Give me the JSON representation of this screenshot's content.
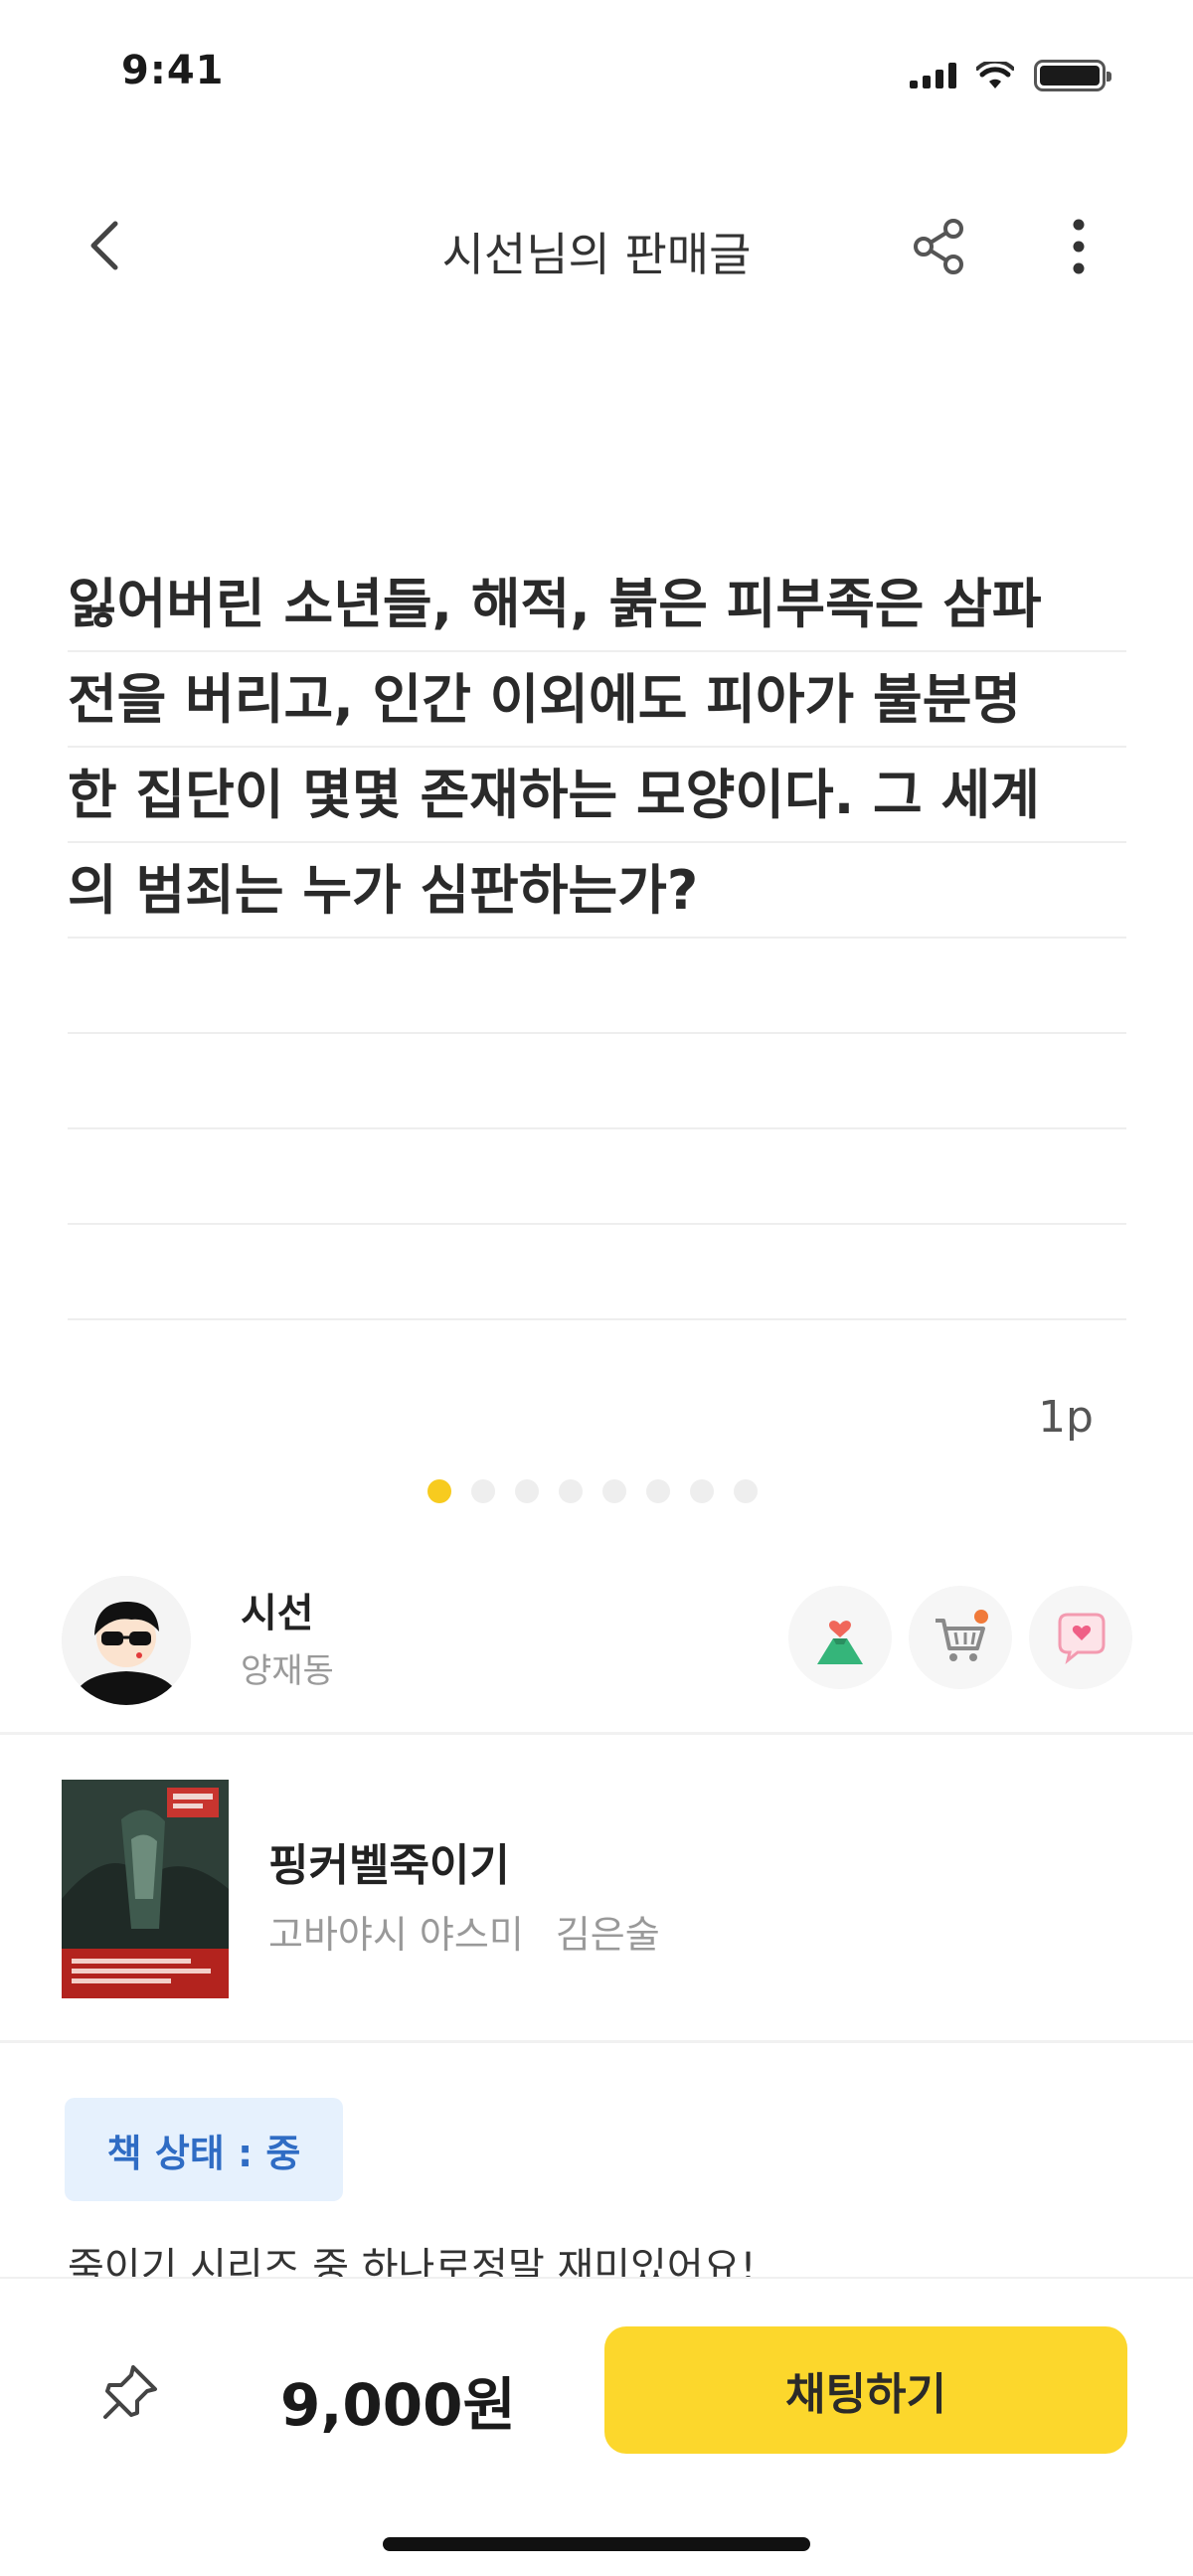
{
  "status_bar": {
    "time": "9:41"
  },
  "header": {
    "title": "시선님의 판매글"
  },
  "note": {
    "lines": [
      "잃어버린 소년들, 해적, 붉은 피부족은 삼파",
      "전을 버리고, 인간 이외에도 피아가 불분명",
      "한 집단이 몇몇 존재하는 모양이다. 그 세계",
      "의 범죄는 누가 심판하는가?",
      "",
      "",
      "",
      ""
    ],
    "page_number": "1p",
    "total_pages": 8,
    "active_page": 1
  },
  "seller": {
    "name": "시선",
    "location": "양재동"
  },
  "book": {
    "title": "핑커벨죽이기",
    "author": "고바야시 야스미",
    "translator": "김은술"
  },
  "listing": {
    "condition": "책 상태 : 중",
    "description": "죽이기 시리즈 중 하나로정말 재미있어요!"
  },
  "bottom_bar": {
    "price": "9,000원",
    "chat_label": "채팅하기"
  },
  "colors": {
    "accent": "#fcd72c",
    "active_dot": "#f7cb1f",
    "tag_bg": "#e6f1fd",
    "tag_text": "#2f6cc4"
  }
}
